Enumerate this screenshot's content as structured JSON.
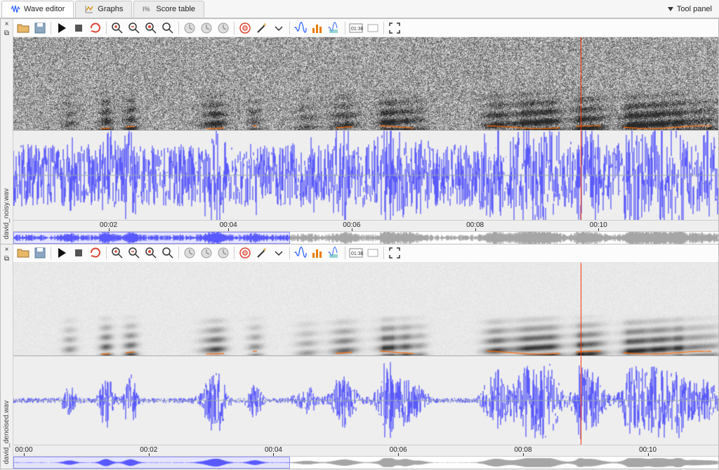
{
  "tabs": {
    "wave_editor": "Wave editor",
    "graphs": "Graphs",
    "score_table": "Score table"
  },
  "tool_panel_label": "Tool panel",
  "toolbar_buttons": {
    "open": "open-file",
    "save": "save-file",
    "play": "play",
    "stop": "stop",
    "loop": "loop",
    "zoom_in": "zoom-in",
    "zoom_out": "zoom-out",
    "zoom_fit": "zoom-fit",
    "zoom_sel": "zoom-selection",
    "timer_a": "time-display-a",
    "timer_b": "time-display-b",
    "timer_c": "time-display-c",
    "target": "target",
    "wand": "magic-wand",
    "dropdown": "filter-dropdown",
    "view_wave": "view-waveform",
    "view_spec": "view-spectrogram",
    "view_both": "view-both",
    "time_counter": "time-counter",
    "blank": "blank-toggle",
    "fullscreen": "fullscreen"
  },
  "time_counter_label": "01:36",
  "panes": [
    {
      "filename": "david_noisy.wav",
      "noise_level": 0.74,
      "speckle": 0.9,
      "cursor_frac": 0.805,
      "overview_sel_frac": 0.392,
      "time_labels": [
        "00:02",
        "00:04",
        "00:06",
        "00:08",
        "00:10"
      ],
      "time_label_fracs": [
        0.135,
        0.305,
        0.48,
        0.655,
        0.83
      ],
      "show_leading_label": false,
      "seed": 9127
    },
    {
      "filename": "david_denoised.wav",
      "noise_level": 0.06,
      "speckle": 0.08,
      "cursor_frac": 0.805,
      "overview_sel_frac": 0.392,
      "time_labels": [
        "00:00",
        "00:02",
        "00:04",
        "00:06",
        "00:08",
        "00:10"
      ],
      "time_label_fracs": [
        0.015,
        0.192,
        0.369,
        0.546,
        0.723,
        0.9
      ],
      "show_leading_label": true,
      "seed": 9127
    }
  ],
  "colors": {
    "waveform": "#2929ff",
    "cursor": "#ff3300",
    "spec_mark": "#ff6a00"
  }
}
